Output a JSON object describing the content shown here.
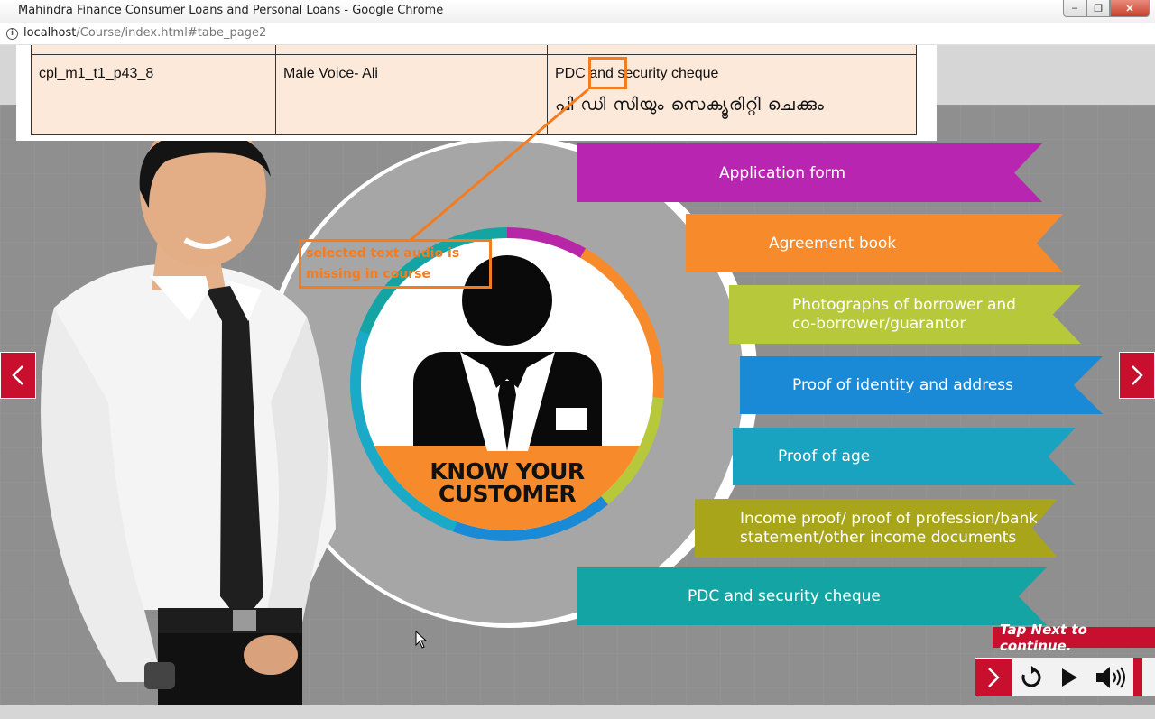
{
  "window": {
    "title": "Mahindra Finance Consumer Loans and Personal Loans - Google Chrome",
    "minimize": "–",
    "restore": "❐",
    "close": "✕"
  },
  "address": {
    "host": "localhost",
    "path": "/Course/index.html#tabe_page2"
  },
  "doc_row": {
    "id": "cpl_m1_t1_p43_8",
    "voice": "Male Voice- Ali",
    "text_en": "PDC and security cheque",
    "text_ml": "പി ഡി സിയും സെക്യൂരിറ്റി ചെക്കും"
  },
  "annotation": {
    "note": "selected text audio is missing in course"
  },
  "kyc": {
    "line1": "KNOW YOUR",
    "line2": "CUSTOMER"
  },
  "ribbons": [
    {
      "label": "Application form",
      "color": "#b826b1"
    },
    {
      "label": "Agreement book",
      "color": "#f78a2a"
    },
    {
      "label": "Photographs of borrower and",
      "label2": "co-borrower/guarantor",
      "color": "#b7c93a"
    },
    {
      "label": "Proof of identity and address",
      "color": "#1b8ad6"
    },
    {
      "label": "Proof of age",
      "color": "#1aa3c0"
    },
    {
      "label": "Income proof/ proof of profession/bank",
      "label2": "statement/other income documents",
      "color": "#a8a51b"
    },
    {
      "label": "PDC and security cheque",
      "color": "#15a4a4"
    }
  ],
  "controls": {
    "tap_next": "Tap Next to continue."
  },
  "icons": [
    "info-icon",
    "chevron-left-icon",
    "chevron-right-icon",
    "replay-icon",
    "play-icon",
    "volume-icon",
    "mouse-cursor-icon"
  ],
  "colors": {
    "brand_red": "#c8102e",
    "annotation_orange": "#f47c20"
  }
}
